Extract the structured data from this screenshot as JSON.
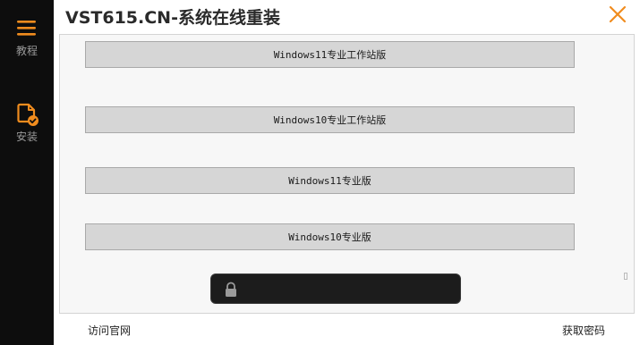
{
  "app": {
    "title": "VST615.CN-系统在线重装"
  },
  "sidebar": {
    "items": [
      {
        "label": "教程",
        "icon": "menu-icon"
      },
      {
        "label": "安装",
        "icon": "document-check-icon"
      }
    ]
  },
  "versions": [
    {
      "label": "Windows11专业工作站版"
    },
    {
      "label": "Windows10专业工作站版"
    },
    {
      "label": "Windows11专业版"
    },
    {
      "label": "Windows10专业版"
    }
  ],
  "password": {
    "value": "",
    "placeholder": ""
  },
  "footer": {
    "visit_site_label": "访问官网",
    "get_password_label": "获取密码"
  },
  "colors": {
    "accent": "#f08c1e",
    "sidebar_bg": "#0d0d0d",
    "button_bg": "#d6d6d6",
    "password_bg": "#1c1c1c"
  }
}
